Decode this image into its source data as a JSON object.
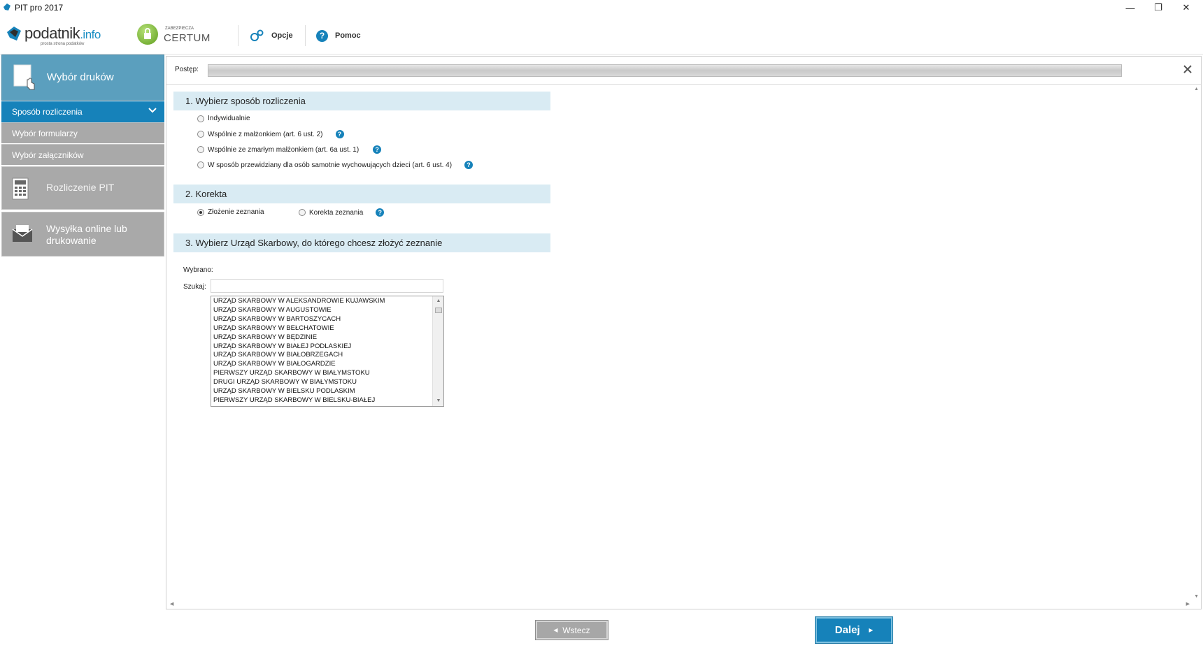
{
  "window": {
    "title": "PIT pro 2017",
    "controls": {
      "minimize": "—",
      "restore": "❐",
      "close": "✕"
    }
  },
  "toolbar": {
    "logo_text": "podatnik",
    "logo_suffix": ".info",
    "logo_tagline": "prosta strona podatków",
    "certum_small": "ZABEZPIECZA",
    "certum_big": "CERTUM",
    "options_label": "Opcje",
    "help_label": "Pomoc"
  },
  "sidebar": {
    "step1_label": "Wybór druków",
    "sub_items": [
      {
        "label": "Sposób rozliczenia"
      },
      {
        "label": "Wybór formularzy"
      },
      {
        "label": "Wybór załączników"
      }
    ],
    "step2_label": "Rozliczenie PIT",
    "step3_line1": "Wysyłka online lub",
    "step3_line2": "drukowanie"
  },
  "progress": {
    "label": "Postęp:",
    "value": 1.0
  },
  "section1": {
    "title": "1. Wybierz sposób rozliczenia",
    "options": [
      {
        "label": "Indywidualnie",
        "checked": false,
        "help": false
      },
      {
        "label": "Wspólnie z małżonkiem (art. 6 ust. 2)",
        "checked": false,
        "help": true
      },
      {
        "label": "Wspólnie ze zmarłym małżonkiem (art. 6a ust. 1)",
        "checked": false,
        "help": true
      },
      {
        "label": "W sposób przewidziany dla osób samotnie wychowujących dzieci (art. 6 ust. 4)",
        "checked": false,
        "help": true
      }
    ]
  },
  "section2": {
    "title": "2. Korekta",
    "option_submit": "Złożenie zeznania",
    "option_correct": "Korekta zeznania"
  },
  "section3": {
    "title": "3. Wybierz Urząd Skarbowy, do którego chcesz złożyć zeznanie",
    "selected_label": "Wybrano:",
    "search_label": "Szukaj:",
    "search_value": "",
    "offices": [
      "URZĄD SKARBOWY W ALEKSANDROWIE KUJAWSKIM",
      "URZĄD SKARBOWY W AUGUSTOWIE",
      "URZĄD SKARBOWY W BARTOSZYCACH",
      "URZĄD SKARBOWY W BEŁCHATOWIE",
      "URZĄD SKARBOWY W BĘDZINIE",
      "URZĄD SKARBOWY W BIAŁEJ PODLASKIEJ",
      "URZĄD SKARBOWY W BIAŁOBRZEGACH",
      "URZĄD SKARBOWY W BIAŁOGARDZIE",
      "PIERWSZY URZĄD SKARBOWY W BIAŁYMSTOKU",
      "DRUGI URZĄD SKARBOWY W BIAŁYMSTOKU",
      "URZĄD SKARBOWY W BIELSKU PODLASKIM",
      "PIERWSZY URZĄD SKARBOWY W BIELSKU-BIAŁEJ"
    ]
  },
  "buttons": {
    "back_label": "Wstecz",
    "next_label": "Dalej"
  },
  "colors": {
    "accent": "#1682ba",
    "sidebar_step_active": "#5b9fbe",
    "sidebar_gray": "#a9a9a9",
    "section_header": "#d9ebf3"
  }
}
